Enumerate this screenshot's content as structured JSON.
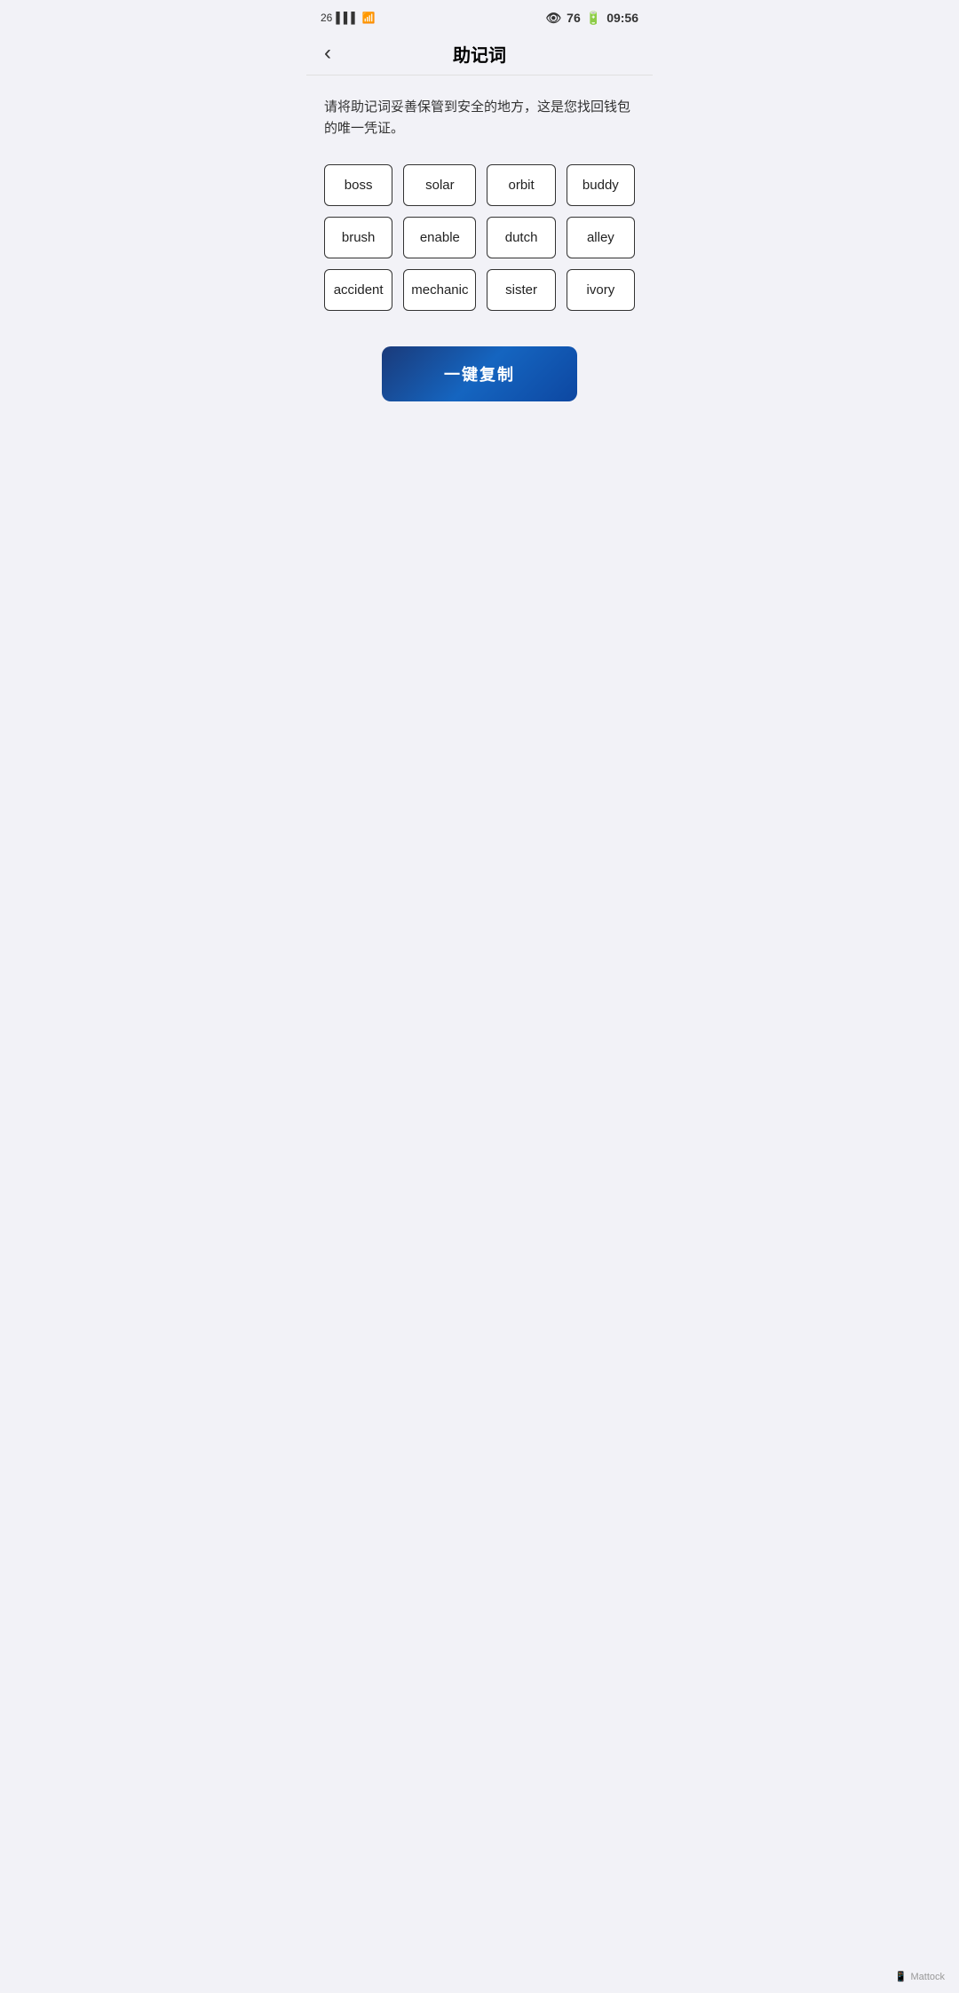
{
  "statusBar": {
    "network": "26",
    "time": "09:56",
    "battery": "76"
  },
  "header": {
    "backIcon": "‹",
    "title": "助记词"
  },
  "description": "请将助记词妥善保管到安全的地方，这是您找回钱包的唯一凭证。",
  "words": [
    {
      "id": 1,
      "text": "boss"
    },
    {
      "id": 2,
      "text": "solar"
    },
    {
      "id": 3,
      "text": "orbit"
    },
    {
      "id": 4,
      "text": "buddy"
    },
    {
      "id": 5,
      "text": "brush"
    },
    {
      "id": 6,
      "text": "enable"
    },
    {
      "id": 7,
      "text": "dutch"
    },
    {
      "id": 8,
      "text": "alley"
    },
    {
      "id": 9,
      "text": "accident"
    },
    {
      "id": 10,
      "text": "mechanic"
    },
    {
      "id": 11,
      "text": "sister"
    },
    {
      "id": 12,
      "text": "ivory"
    }
  ],
  "copyButton": {
    "label": "一键复制"
  },
  "footer": {
    "brand": "Mattock"
  }
}
